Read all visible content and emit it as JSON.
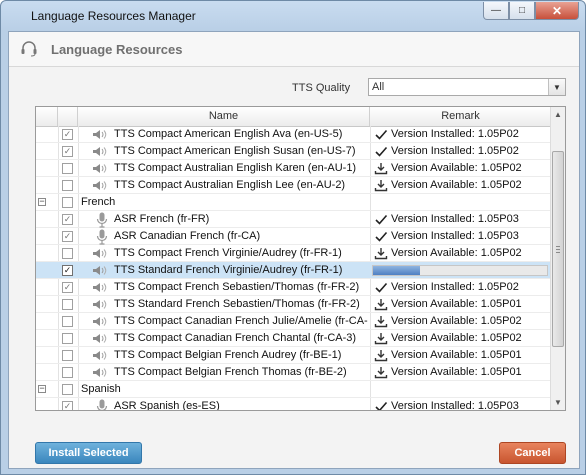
{
  "window": {
    "title": "Language Resources Manager",
    "minimize_glyph": "—",
    "maximize_glyph": "□",
    "close_glyph": "✕"
  },
  "header": {
    "title": "Language Resources"
  },
  "quality": {
    "label": "TTS Quality",
    "value": "All"
  },
  "grid": {
    "columns": {
      "name": "Name",
      "remark": "Remark"
    },
    "rows": [
      {
        "kind": "item",
        "icon": "speaker",
        "checked": true,
        "enabled": false,
        "name": "TTS Compact American English Ava (en-US-5)",
        "status": "installed",
        "remark": "Version Installed: 1.05P02"
      },
      {
        "kind": "item",
        "icon": "speaker",
        "checked": true,
        "enabled": false,
        "name": "TTS Compact American English Susan (en-US-7)",
        "status": "installed",
        "remark": "Version Installed: 1.05P02"
      },
      {
        "kind": "item",
        "icon": "speaker",
        "checked": false,
        "enabled": true,
        "name": "TTS Compact Australian English Karen (en-AU-1)",
        "status": "available",
        "remark": "Version Available: 1.05P02"
      },
      {
        "kind": "item",
        "icon": "speaker",
        "checked": false,
        "enabled": true,
        "name": "TTS Compact Australian English Lee (en-AU-2)",
        "status": "available",
        "remark": "Version Available: 1.05P02"
      },
      {
        "kind": "group",
        "expander": "−",
        "checked": false,
        "name": "French"
      },
      {
        "kind": "item",
        "icon": "mic",
        "checked": true,
        "enabled": false,
        "name": "ASR French (fr-FR)",
        "status": "installed",
        "remark": "Version Installed: 1.05P03"
      },
      {
        "kind": "item",
        "icon": "mic",
        "checked": true,
        "enabled": false,
        "name": "ASR Canadian French (fr-CA)",
        "status": "installed",
        "remark": "Version Installed: 1.05P03"
      },
      {
        "kind": "item",
        "icon": "speaker",
        "checked": false,
        "enabled": true,
        "name": "TTS Compact French Virginie/Audrey (fr-FR-1)",
        "status": "available",
        "remark": "Version Available: 1.05P02"
      },
      {
        "kind": "item",
        "icon": "speaker",
        "checked": true,
        "enabled": true,
        "selected": true,
        "name": "TTS Standard French Virginie/Audrey (fr-FR-1)",
        "status": "progress",
        "progress": 0.27
      },
      {
        "kind": "item",
        "icon": "speaker",
        "checked": true,
        "enabled": false,
        "name": "TTS Compact French Sebastien/Thomas (fr-FR-2)",
        "status": "installed",
        "remark": "Version Installed: 1.05P02"
      },
      {
        "kind": "item",
        "icon": "speaker",
        "checked": false,
        "enabled": true,
        "name": "TTS Standard French Sebastien/Thomas (fr-FR-2)",
        "status": "available",
        "remark": "Version Available: 1.05P01"
      },
      {
        "kind": "item",
        "icon": "speaker",
        "checked": false,
        "enabled": true,
        "name": "TTS Compact Canadian French Julie/Amelie (fr-CA-1)",
        "status": "available",
        "remark": "Version Available: 1.05P02"
      },
      {
        "kind": "item",
        "icon": "speaker",
        "checked": false,
        "enabled": true,
        "name": "TTS Compact Canadian French Chantal (fr-CA-3)",
        "status": "available",
        "remark": "Version Available: 1.05P02"
      },
      {
        "kind": "item",
        "icon": "speaker",
        "checked": false,
        "enabled": true,
        "name": "TTS Compact Belgian French Audrey (fr-BE-1)",
        "status": "available",
        "remark": "Version Available: 1.05P01"
      },
      {
        "kind": "item",
        "icon": "speaker",
        "checked": false,
        "enabled": true,
        "name": "TTS Compact Belgian French Thomas (fr-BE-2)",
        "status": "available",
        "remark": "Version Available: 1.05P01"
      },
      {
        "kind": "group",
        "expander": "−",
        "checked": false,
        "name": "Spanish"
      },
      {
        "kind": "item",
        "icon": "mic",
        "checked": true,
        "enabled": false,
        "name": "ASR Spanish (es-ES)",
        "status": "installed",
        "remark": "Version Installed: 1.05P03"
      }
    ]
  },
  "buttons": {
    "install": "Install Selected",
    "cancel": "Cancel"
  },
  "scrollbar": {
    "up_glyph": "▲",
    "down_glyph": "▼"
  },
  "colors": {
    "install_button": "#3a86bd",
    "cancel_button": "#c8552f",
    "selected_row": "#cce3f6",
    "progress_fill": "#4f80c2"
  }
}
